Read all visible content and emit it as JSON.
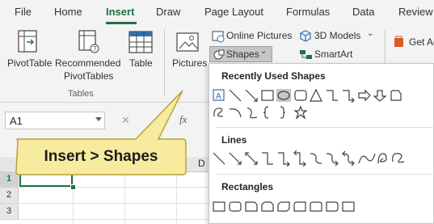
{
  "tabs": [
    "File",
    "Home",
    "Insert",
    "Draw",
    "Page Layout",
    "Formulas",
    "Data",
    "Review"
  ],
  "ribbon": {
    "pivot_table": "PivotTable",
    "recommended_line1": "Recommended",
    "recommended_line2": "PivotTables",
    "table": "Table",
    "tables_group": "Tables",
    "pictures": "Pictures",
    "online_pictures": "Online Pictures",
    "shapes": "Shapes",
    "models_3d": "3D Models",
    "smartart": "SmartArt",
    "get_addins": "Get Ad"
  },
  "formula_bar": {
    "name_box": "A1",
    "cancel": "✕",
    "fx": "fx"
  },
  "grid": {
    "col_d": "D",
    "rows": [
      "1",
      "2",
      "3"
    ]
  },
  "callout": {
    "text": "Insert > Shapes"
  },
  "shapes_panel": {
    "recent_title": "Recently Used Shapes",
    "lines_title": "Lines",
    "rectangles_title": "Rectangles"
  },
  "colors": {
    "accent": "#1f7145",
    "callout_fill": "#f7eba0",
    "callout_border": "#b9a23a"
  }
}
